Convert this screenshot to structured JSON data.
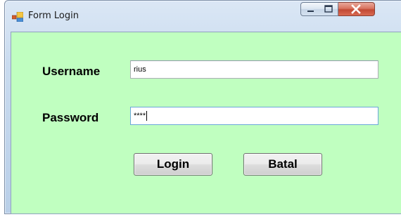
{
  "window": {
    "title": "Form Login",
    "icon": "form-icon",
    "controls": [
      "minimize-icon",
      "maximize-icon",
      "close-icon"
    ]
  },
  "form": {
    "background_color": "#c0ffc0",
    "username_label": "Username",
    "username_value": "rius",
    "password_label": "Password",
    "password_value": "****",
    "login_button": "Login",
    "cancel_button": "Batal"
  }
}
